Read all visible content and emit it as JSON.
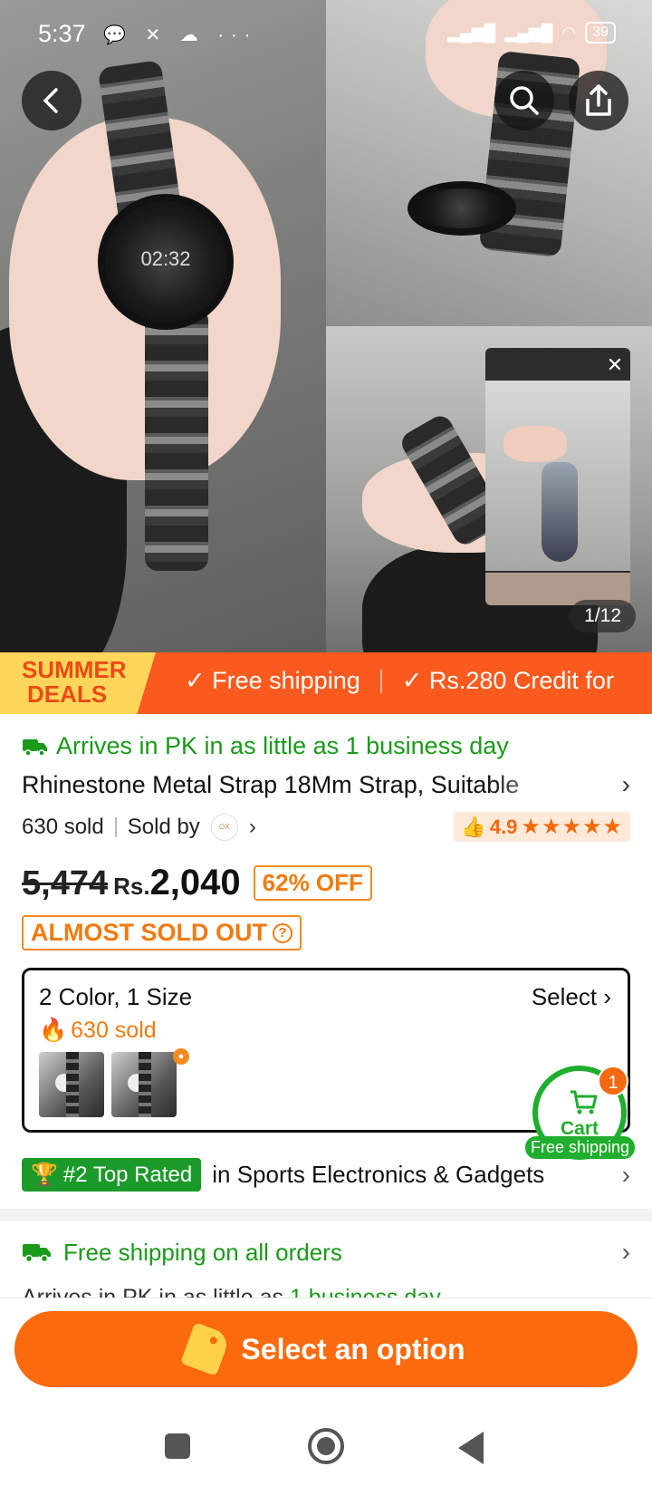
{
  "status_bar": {
    "time": "5:37",
    "icons_left": "💬 ✕ ☁ ···",
    "battery": "39"
  },
  "gallery": {
    "watch_time": "02:32",
    "counter": "1/12"
  },
  "promo": {
    "summer_line1": "SUMMER",
    "summer_line2": "DEALS",
    "item1": "✓ Free shipping",
    "item2": "✓ Rs.280 Credit for"
  },
  "product": {
    "arrives": "Arrives in PK in as little as 1 business day",
    "title": "Rhinestone Metal Strap 18Mm Strap, Suitable",
    "sold": "630 sold",
    "sold_by": "Sold by",
    "seller_logo": "OX",
    "rating": "4.9",
    "stars": "★★★★★",
    "old_price": "5,474",
    "currency": "Rs.",
    "price": "2,040",
    "off": "62% OFF",
    "almost_sold_out": "ALMOST SOLD OUT"
  },
  "variants": {
    "title": "2 Color, 1 Size",
    "select": "Select",
    "sold": "630 sold"
  },
  "cart": {
    "label": "Cart",
    "count": "1",
    "free_shipping": "Free shipping"
  },
  "rank": {
    "badge": "#2 Top Rated",
    "text": "in Sports Electronics & Gadgets"
  },
  "shipping": {
    "title": "Free shipping on all orders",
    "sub_prefix": "Arrives in PK in as little as ",
    "sub_link": "1 business day"
  },
  "cta": {
    "label": "Select an option"
  },
  "colors": {
    "accent": "#fb6a0c",
    "green": "#1a9a1a",
    "promo": "#fb5a1f"
  }
}
